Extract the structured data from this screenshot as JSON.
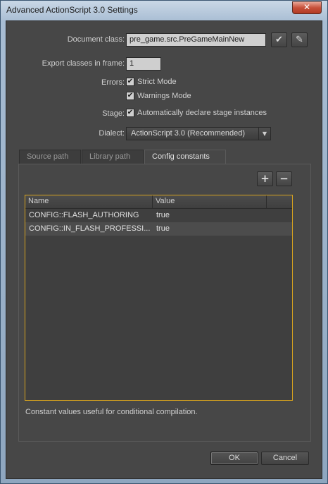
{
  "window": {
    "title": "Advanced ActionScript 3.0 Settings",
    "close_glyph": "✕"
  },
  "document_class": {
    "label": "Document class:",
    "value": "pre_game.src.PreGameMainNew",
    "validate_icon": "check-icon",
    "validate_glyph": "✔",
    "edit_icon": "pencil-icon",
    "edit_glyph": "✎"
  },
  "export_frame": {
    "label": "Export classes in frame:",
    "value": "1"
  },
  "errors": {
    "label": "Errors:",
    "strict_mode": {
      "label": "Strict Mode",
      "checked": true
    },
    "warnings_mode": {
      "label": "Warnings Mode",
      "checked": true
    }
  },
  "stage": {
    "label": "Stage:",
    "auto_declare": {
      "label": "Automatically declare stage instances",
      "checked": true
    }
  },
  "dialect": {
    "label": "Dialect:",
    "value": "ActionScript 3.0 (Recommended)"
  },
  "check_glyph": "✔",
  "dropdown_glyph": "▼",
  "tabs": [
    {
      "label": "Source path",
      "active": false
    },
    {
      "label": "Library path",
      "active": false
    },
    {
      "label": "Config constants",
      "active": true
    }
  ],
  "toolbar": {
    "add_glyph": "+",
    "remove_glyph": "−"
  },
  "table": {
    "headers": {
      "name": "Name",
      "value": "Value"
    },
    "rows": [
      {
        "name": "CONFIG::FLASH_AUTHORING",
        "value": "true"
      },
      {
        "name": "CONFIG::IN_FLASH_PROFESSI...",
        "value": "true"
      }
    ]
  },
  "help_text": "Constant values useful for conditional compilation.",
  "buttons": {
    "ok": "OK",
    "cancel": "Cancel"
  }
}
